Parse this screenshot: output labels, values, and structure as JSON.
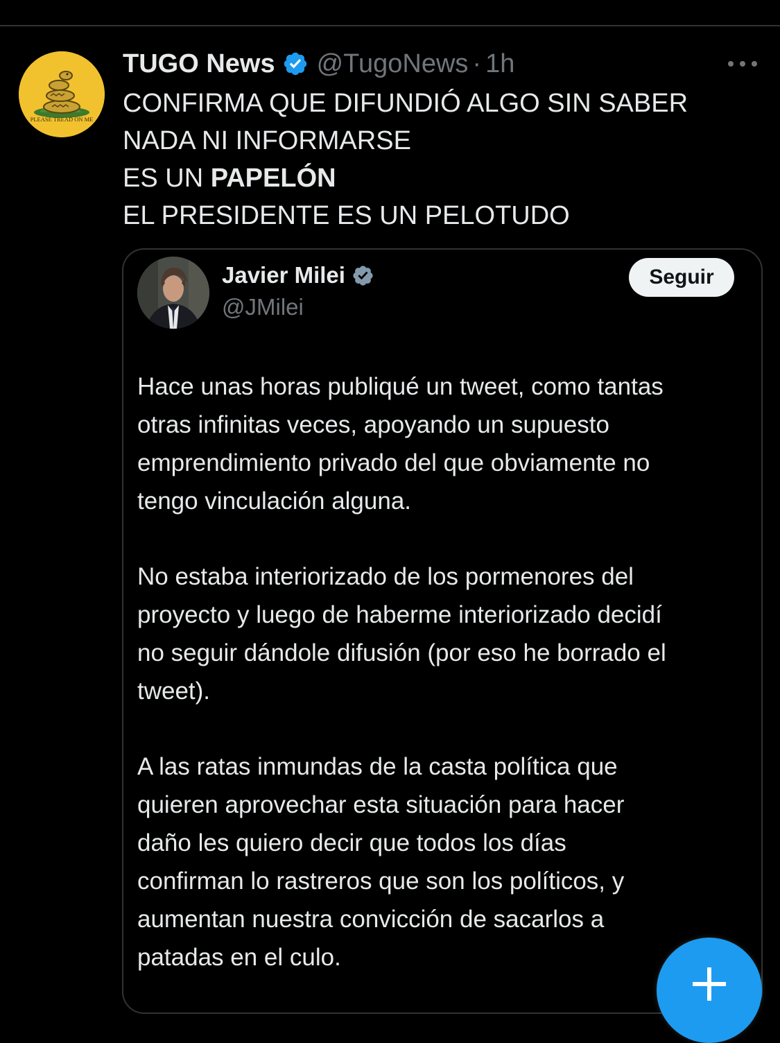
{
  "tweet": {
    "display_name": "TUGO News",
    "handle": "@TugoNews",
    "separator": "·",
    "time": "1h",
    "avatar_text": "PLEASE TREAD ON ME",
    "text_lines": [
      "CONFIRMA QUE DIFUNDIÓ ALGO SIN SABER",
      "NADA NI INFORMARSE"
    ],
    "line3_prefix": "ES UN ",
    "line3_bold": "PAPELÓN",
    "line4": "EL PRESIDENTE ES UN PELOTUDO",
    "more_icon": "more-horizontal-icon"
  },
  "quote": {
    "display_name": "Javier Milei",
    "handle": "@JMilei",
    "follow_label": "Seguir",
    "paragraphs": [
      [
        "Hace unas horas publiqué un tweet, como tantas",
        "otras infinitas veces, apoyando un supuesto",
        "emprendimiento privado del que obviamente no",
        "tengo vinculación alguna."
      ],
      [
        "No estaba interiorizado de los pormenores del",
        "proyecto y luego de haberme interiorizado decidí",
        "no seguir dándole difusión (por eso he borrado el",
        "tweet)."
      ],
      [
        "A las ratas inmundas de la casta política que",
        "quieren aprovechar esta situación para hacer",
        "daño les quiero decir que todos los días",
        "confirman lo rastreros que son los políticos, y",
        "aumentan nuestra convicción de sacarlos a",
        "patadas en el culo."
      ]
    ]
  },
  "colors": {
    "background": "#000000",
    "verified_blue": "#1d9bf0",
    "verified_gray": "#829aab",
    "fab_blue": "#1d9bf0",
    "secondary_text": "#71767b"
  },
  "fab": {
    "icon": "plus-icon"
  }
}
